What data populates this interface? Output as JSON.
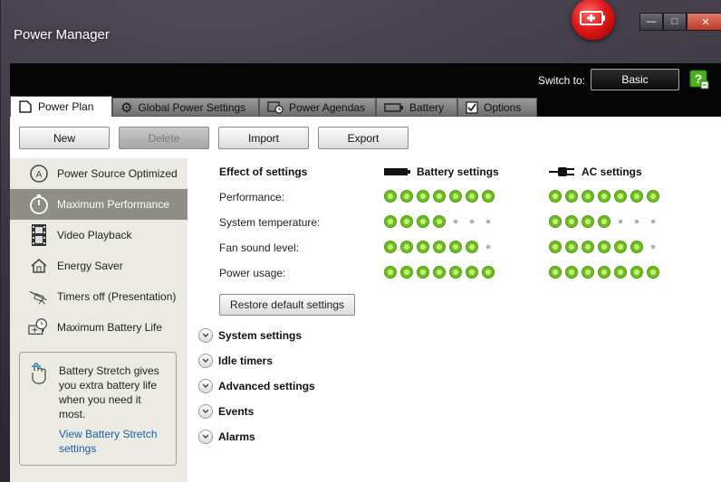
{
  "window": {
    "title": "Power Manager",
    "switch_to_label": "Switch to:",
    "switch_mode": "Basic"
  },
  "tabs": [
    {
      "label": "Power Plan",
      "icon": "document-icon",
      "active": true
    },
    {
      "label": "Global Power Settings",
      "icon": "gear-icon"
    },
    {
      "label": "Power Agendas",
      "icon": "clock-icon"
    },
    {
      "label": "Battery",
      "icon": "battery-icon"
    },
    {
      "label": "Options",
      "icon": "checkbox-icon"
    }
  ],
  "toolbar": {
    "new": "New",
    "delete": "Delete",
    "import": "Import",
    "export": "Export"
  },
  "sidebar": {
    "items": [
      {
        "label": "Power Source Optimized",
        "icon": "power-source-icon"
      },
      {
        "label": "Maximum Performance",
        "icon": "stopwatch-icon",
        "active": true
      },
      {
        "label": "Video Playback",
        "icon": "film-icon"
      },
      {
        "label": "Energy Saver",
        "icon": "house-icon"
      },
      {
        "label": "Timers off (Presentation)",
        "icon": "projector-icon"
      },
      {
        "label": "Maximum Battery Life",
        "icon": "battery-clock-icon"
      }
    ],
    "stretch_text": "Battery Stretch gives you extra battery life when you need it most.",
    "stretch_link": "View Battery Stretch settings"
  },
  "effects": {
    "heading": "Effect of settings",
    "battery_heading": "Battery settings",
    "ac_heading": "AC settings",
    "rows": [
      {
        "label": "Performance:",
        "battery": 7,
        "ac": 7,
        "max": 7
      },
      {
        "label": "System temperature:",
        "battery": 4,
        "ac": 4,
        "max": 7
      },
      {
        "label": "Fan sound level:",
        "battery": 6,
        "ac": 6,
        "max": 7
      },
      {
        "label": "Power usage:",
        "battery": 7,
        "ac": 7,
        "max": 7
      }
    ],
    "restore": "Restore default settings"
  },
  "sections": [
    "System settings",
    "Idle timers",
    "Advanced settings",
    "Events",
    "Alarms"
  ],
  "colors": {
    "dot_on": "#6cbf1e",
    "active_sidebar": "#8e8e86",
    "link": "#1a5fa8"
  }
}
